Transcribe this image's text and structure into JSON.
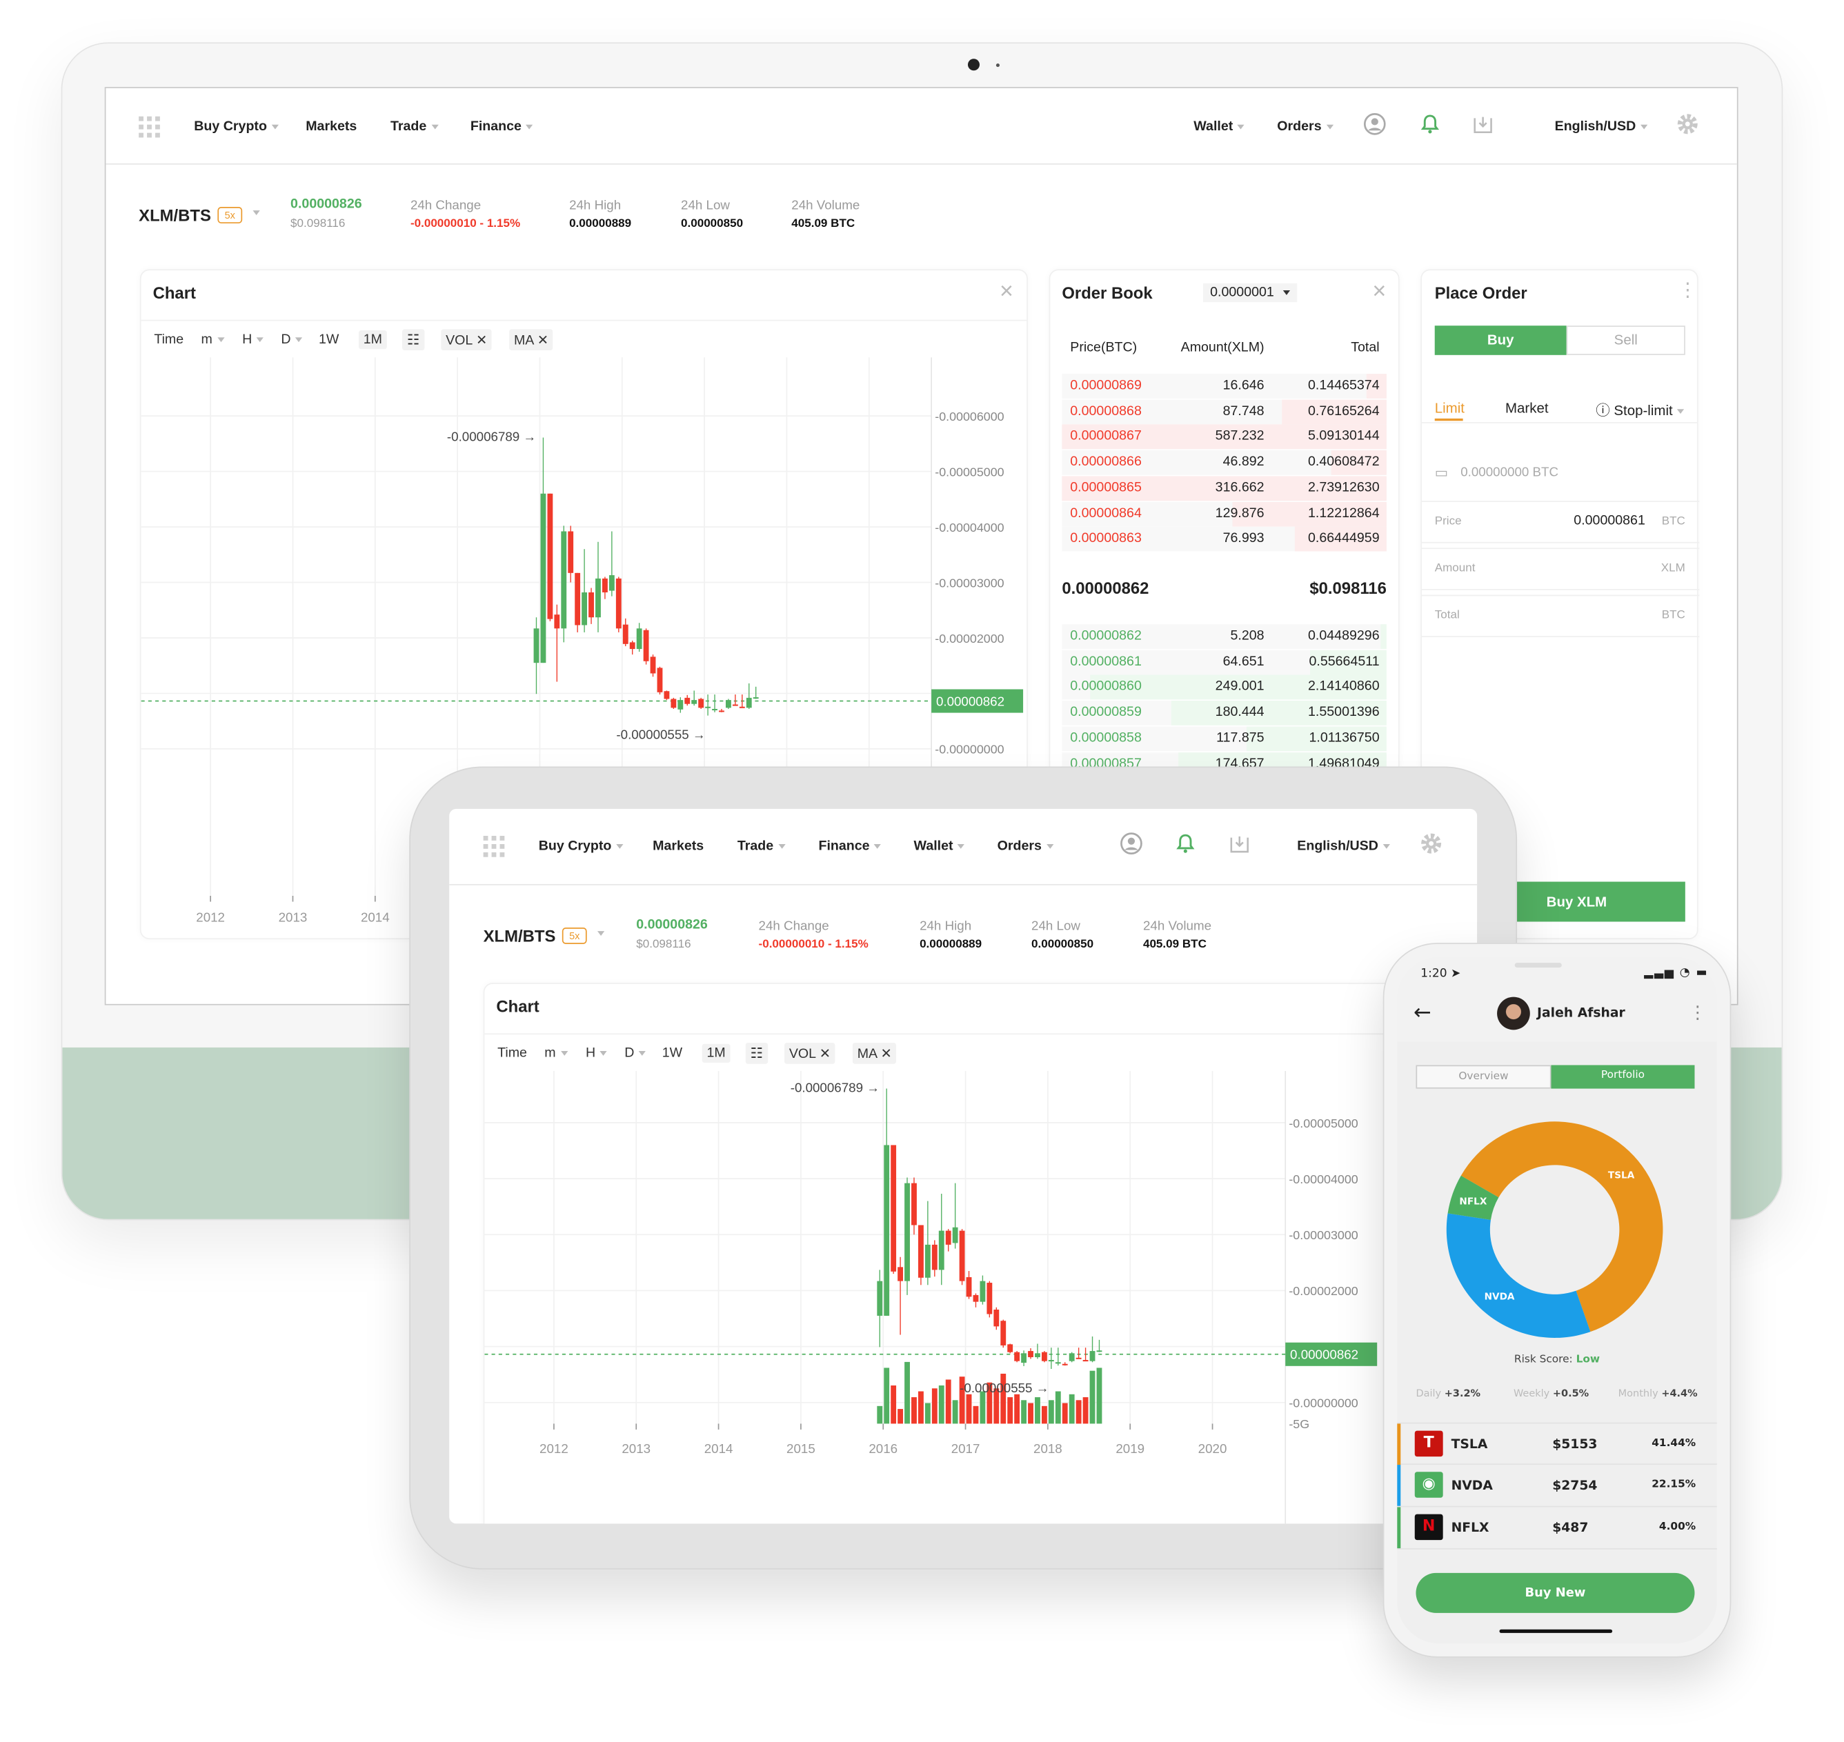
{
  "nav": {
    "left_items": [
      {
        "label": "Buy Crypto",
        "dropdown": true
      },
      {
        "label": "Markets",
        "dropdown": false
      },
      {
        "label": "Trade",
        "dropdown": true
      },
      {
        "label": "Finance",
        "dropdown": true
      }
    ],
    "right_items": [
      {
        "label": "Wallet",
        "dropdown": true
      },
      {
        "label": "Orders",
        "dropdown": true
      }
    ],
    "language": "English/USD",
    "icons": [
      "apps-grid-icon",
      "user-icon",
      "bell-icon",
      "download-icon",
      "gear-icon"
    ]
  },
  "ticker": {
    "pair": "XLM/BTS",
    "leverage": "5x",
    "price": "0.00000826",
    "price_usd": "$0.098116",
    "change_label": "24h Change",
    "change_value": "-0.00000010 - 1.15%",
    "high_label": "24h High",
    "high_value": "0.00000889",
    "low_label": "24h Low",
    "low_value": "0.00000850",
    "volume_label": "24h Volume",
    "volume_value": "405.09 BTC"
  },
  "chart_panel": {
    "title": "Chart",
    "toolbar": [
      {
        "label": "Time",
        "dropdown": false
      },
      {
        "label": "m",
        "dropdown": true
      },
      {
        "label": "H",
        "dropdown": true
      },
      {
        "label": "D",
        "dropdown": true
      },
      {
        "label": "1W",
        "dropdown": false
      },
      {
        "label": "1M",
        "dropdown": false,
        "selected": true
      }
    ],
    "indicators": [
      {
        "label": "VOL"
      },
      {
        "label": "MA"
      }
    ]
  },
  "chart_data": {
    "type": "candlestick",
    "x_ticks": [
      "2012",
      "2013",
      "2014",
      "2015",
      "2016",
      "2017",
      "2018",
      "2019",
      "2020"
    ],
    "y_ticks": [
      "-0.00000000",
      "-0.00001000",
      "-0.00002000",
      "-0.00003000",
      "-0.00004000",
      "-0.00005000",
      "-0.00006000"
    ],
    "y_tick_values": [
      0,
      1e-05,
      2e-05,
      3e-05,
      4e-05,
      5e-05,
      6e-05
    ],
    "volume_axis_label": "-5G",
    "high_annotation": "-0.00006789",
    "low_annotation": "-0.00000555",
    "last_price": "0.00000862",
    "last_price_value": 8.62e-06,
    "candles": [
      {
        "date": "2015-12",
        "o": 1.55e-05,
        "h": 2.37e-05,
        "l": 9.9e-06,
        "c": 2.17e-05,
        "v": 0.6
      },
      {
        "date": "2016-01",
        "o": 1.55e-05,
        "h": 5.61e-05,
        "l": 1.55e-05,
        "c": 4.6e-05,
        "v": 1.9
      },
      {
        "date": "2016-02",
        "o": 4.6e-05,
        "h": 4.6e-05,
        "l": 2.3e-05,
        "c": 2.34e-05,
        "v": 1.3
      },
      {
        "date": "2016-03",
        "o": 2.42e-05,
        "h": 2.6e-05,
        "l": 1.21e-05,
        "c": 2.17e-05,
        "v": 0.5
      },
      {
        "date": "2016-04",
        "o": 2.17e-05,
        "h": 4.02e-05,
        "l": 1.92e-05,
        "c": 3.92e-05,
        "v": 2.1
      },
      {
        "date": "2016-05",
        "o": 3.92e-05,
        "h": 4.02e-05,
        "l": 3e-05,
        "c": 3.17e-05,
        "v": 0.9
      },
      {
        "date": "2016-06",
        "o": 3.17e-05,
        "h": 3.17e-05,
        "l": 2.1e-05,
        "c": 2.23e-05,
        "v": 1.1
      },
      {
        "date": "2016-07",
        "o": 2.23e-05,
        "h": 3.6e-05,
        "l": 2.1e-05,
        "c": 2.82e-05,
        "v": 0.7
      },
      {
        "date": "2016-08",
        "o": 2.82e-05,
        "h": 2.9e-05,
        "l": 2.25e-05,
        "c": 2.37e-05,
        "v": 1.2
      },
      {
        "date": "2016-09",
        "o": 2.37e-05,
        "h": 3.73e-05,
        "l": 2.1e-05,
        "c": 3.07e-05,
        "v": 1.3
      },
      {
        "date": "2016-10",
        "o": 3.07e-05,
        "h": 3.1e-05,
        "l": 2.7e-05,
        "c": 2.82e-05,
        "v": 1.5
      },
      {
        "date": "2016-11",
        "o": 2.85e-05,
        "h": 3.92e-05,
        "l": 2.75e-05,
        "c": 3.13e-05,
        "v": 0.8
      },
      {
        "date": "2016-12",
        "o": 3.07e-05,
        "h": 3.1e-05,
        "l": 2.1e-05,
        "c": 2.17e-05,
        "v": 1.6
      },
      {
        "date": "2017-01",
        "o": 2.24e-05,
        "h": 2.35e-05,
        "l": 1.85e-05,
        "c": 1.89e-05,
        "v": 1.0
      },
      {
        "date": "2017-02",
        "o": 1.92e-05,
        "h": 1.95e-05,
        "l": 1.7e-05,
        "c": 1.8e-05,
        "v": 0.6
      },
      {
        "date": "2017-03",
        "o": 1.8e-05,
        "h": 2.27e-05,
        "l": 1.75e-05,
        "c": 2.17e-05,
        "v": 1.1
      },
      {
        "date": "2017-04",
        "o": 2.14e-05,
        "h": 2.17e-05,
        "l": 1.52e-05,
        "c": 1.58e-05,
        "v": 1.4
      },
      {
        "date": "2017-05",
        "o": 1.66e-05,
        "h": 1.7e-05,
        "l": 1.3e-05,
        "c": 1.36e-05,
        "v": 1.2
      },
      {
        "date": "2017-06",
        "o": 1.46e-05,
        "h": 1.48e-05,
        "l": 9.8e-06,
        "c": 1.02e-05,
        "v": 1.7
      },
      {
        "date": "2017-07",
        "o": 1.04e-05,
        "h": 1.05e-05,
        "l": 8.8e-06,
        "c": 9e-06,
        "v": 0.9
      },
      {
        "date": "2017-08",
        "o": 9e-06,
        "h": 9.2e-06,
        "l": 7.2e-06,
        "c": 7.4e-06,
        "v": 1.0
      },
      {
        "date": "2017-09",
        "o": 7.1e-06,
        "h": 9.3e-06,
        "l": 6.5e-06,
        "c": 8.8e-06,
        "v": 0.8
      },
      {
        "date": "2017-10",
        "o": 9.2e-06,
        "h": 9.7e-06,
        "l": 7.8e-06,
        "c": 8.1e-06,
        "v": 0.7
      },
      {
        "date": "2017-11",
        "o": 8.1e-06,
        "h": 1.05e-05,
        "l": 7.8e-06,
        "c": 8.8e-06,
        "v": 0.9
      },
      {
        "date": "2017-12",
        "o": 9e-06,
        "h": 9.2e-06,
        "l": 7.2e-06,
        "c": 7.4e-06,
        "v": 0.6
      },
      {
        "date": "2018-01",
        "o": 7.4e-06,
        "h": 9.8e-06,
        "l": 6e-06,
        "c": 7.6e-06,
        "v": 0.8
      },
      {
        "date": "2018-02",
        "o": 7e-06,
        "h": 9.8e-06,
        "l": 6.6e-06,
        "c": 7.2e-06,
        "v": 1.1
      },
      {
        "date": "2018-03",
        "o": 6.9e-06,
        "h": 7.2e-06,
        "l": 6.6e-06,
        "c": 6.8e-06,
        "v": 0.7
      },
      {
        "date": "2018-04",
        "o": 7.4e-06,
        "h": 9e-06,
        "l": 7.2e-06,
        "c": 8.8e-06,
        "v": 1.0
      },
      {
        "date": "2018-05",
        "o": 8e-06,
        "h": 9.8e-06,
        "l": 7.8e-06,
        "c": 7.9e-06,
        "v": 0.8
      },
      {
        "date": "2018-06",
        "o": 7.6e-06,
        "h": 9.8e-06,
        "l": 7.4e-06,
        "c": 7.5e-06,
        "v": 0.9
      },
      {
        "date": "2018-07",
        "o": 7.4e-06,
        "h": 1.18e-05,
        "l": 7.2e-06,
        "c": 9.2e-06,
        "v": 1.8
      },
      {
        "date": "2018-08",
        "o": 9.2e-06,
        "h": 1.12e-05,
        "l": 9e-06,
        "c": 9.3e-06,
        "v": 1.9
      }
    ]
  },
  "order_book": {
    "title": "Order Book",
    "precision": "0.0000001",
    "columns": [
      "Price(BTC)",
      "Amount(XLM)",
      "Total"
    ],
    "asks": [
      [
        "0.00000869",
        "16.646",
        "0.14465374"
      ],
      [
        "0.00000868",
        "87.748",
        "0.76165264"
      ],
      [
        "0.00000867",
        "587.232",
        "5.09130144"
      ],
      [
        "0.00000866",
        "46.892",
        "0.40608472"
      ],
      [
        "0.00000865",
        "316.662",
        "2.73912630"
      ],
      [
        "0.00000864",
        "129.876",
        "1.12212864"
      ],
      [
        "0.00000863",
        "76.993",
        "0.66444959"
      ]
    ],
    "mid_price": "0.00000862",
    "mid_usd": "$0.098116",
    "bids": [
      [
        "0.00000862",
        "5.208",
        "0.04489296"
      ],
      [
        "0.00000861",
        "64.651",
        "0.55664511"
      ],
      [
        "0.00000860",
        "249.001",
        "2.14140860"
      ],
      [
        "0.00000859",
        "180.444",
        "1.55001396"
      ],
      [
        "0.00000858",
        "117.875",
        "1.01136750"
      ],
      [
        "0.00000857",
        "174.657",
        "1.49681049"
      ]
    ]
  },
  "place_order": {
    "title": "Place Order",
    "buy": "Buy",
    "sell": "Sell",
    "tabs": [
      "Limit",
      "Market",
      "Stop-limit"
    ],
    "balance": "0.00000000 BTC",
    "price_label": "Price",
    "price_value": "0.00000861",
    "price_unit": "BTC",
    "amount_label": "Amount",
    "amount_unit": "XLM",
    "total_label": "Total",
    "total_unit": "BTC",
    "submit": "Buy XLM"
  },
  "phone": {
    "time": "1:20",
    "user_name": "Jaleh Afshar",
    "tabs": [
      "Overview",
      "Portfolio"
    ],
    "active_tab": "Portfolio",
    "risk_label": "Risk Score:",
    "risk_value": "Low",
    "stats": [
      {
        "label": "Daily",
        "value": "+3.2%"
      },
      {
        "label": "Weekly",
        "value": "+0.5%"
      },
      {
        "label": "Monthly",
        "value": "+4.4%"
      }
    ],
    "holdings": [
      {
        "ticker": "TSLA",
        "value": "$5153",
        "percent": "41.44%",
        "pct": 41.44,
        "color": "#e8931b",
        "icon": "tesla-logo-icon",
        "icon_bg": "#c8140f"
      },
      {
        "ticker": "NVDA",
        "value": "$2754",
        "percent": "22.15%",
        "pct": 22.15,
        "color": "#1b9ee8",
        "icon": "nvidia-logo-icon",
        "icon_bg": "#4caf5f"
      },
      {
        "ticker": "NFLX",
        "value": "$487",
        "percent": "4.00%",
        "pct": 4.0,
        "color": "#4caf5f",
        "icon": "netflix-logo-icon",
        "icon_bg": "#111"
      }
    ],
    "buy_button": "Buy New"
  },
  "colors": {
    "green": "#52b062",
    "red": "#f03a2a",
    "orange": "#eb9a2d",
    "grey": "#999999"
  }
}
